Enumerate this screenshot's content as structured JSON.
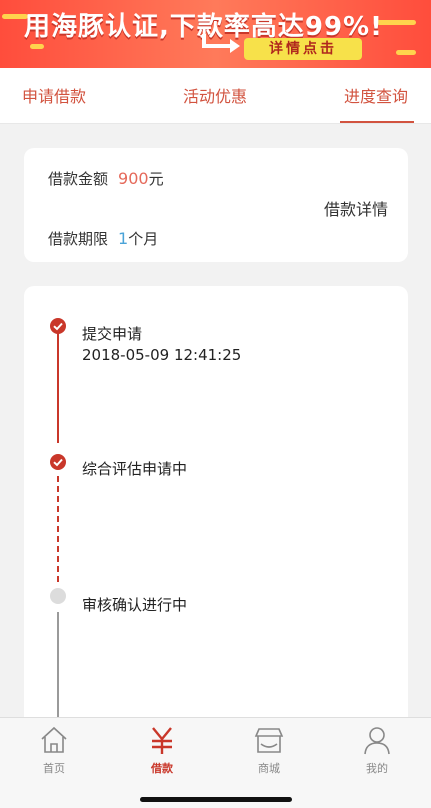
{
  "banner": {
    "headline": "用海豚认证,下款率高达99%!",
    "cta_label": "详情点击"
  },
  "tabs": [
    {
      "label": "申请借款"
    },
    {
      "label": "活动优惠"
    },
    {
      "label": "进度查询"
    }
  ],
  "loan": {
    "amount_label": "借款金额",
    "amount_value": "900",
    "amount_unit": "元",
    "term_label": "借款期限",
    "term_value": "1",
    "term_unit": "个月",
    "detail_link": "借款详情"
  },
  "progress": {
    "steps": [
      {
        "title": "提交申请",
        "time": "2018-05-09 12:41:25",
        "status": "done"
      },
      {
        "title": "综合评估申请中",
        "status": "done"
      },
      {
        "title": "审核确认进行中",
        "status": "pending"
      }
    ]
  },
  "nav": {
    "items": [
      {
        "label": "首页",
        "icon": "home-icon"
      },
      {
        "label": "借款",
        "icon": "yen-icon",
        "active": true
      },
      {
        "label": "商城",
        "icon": "store-icon"
      },
      {
        "label": "我的",
        "icon": "user-icon"
      }
    ]
  },
  "colors": {
    "accent": "#c9372a",
    "tab_text": "#d2533f",
    "amount": "#e5695a",
    "term": "#4aa3d8"
  }
}
